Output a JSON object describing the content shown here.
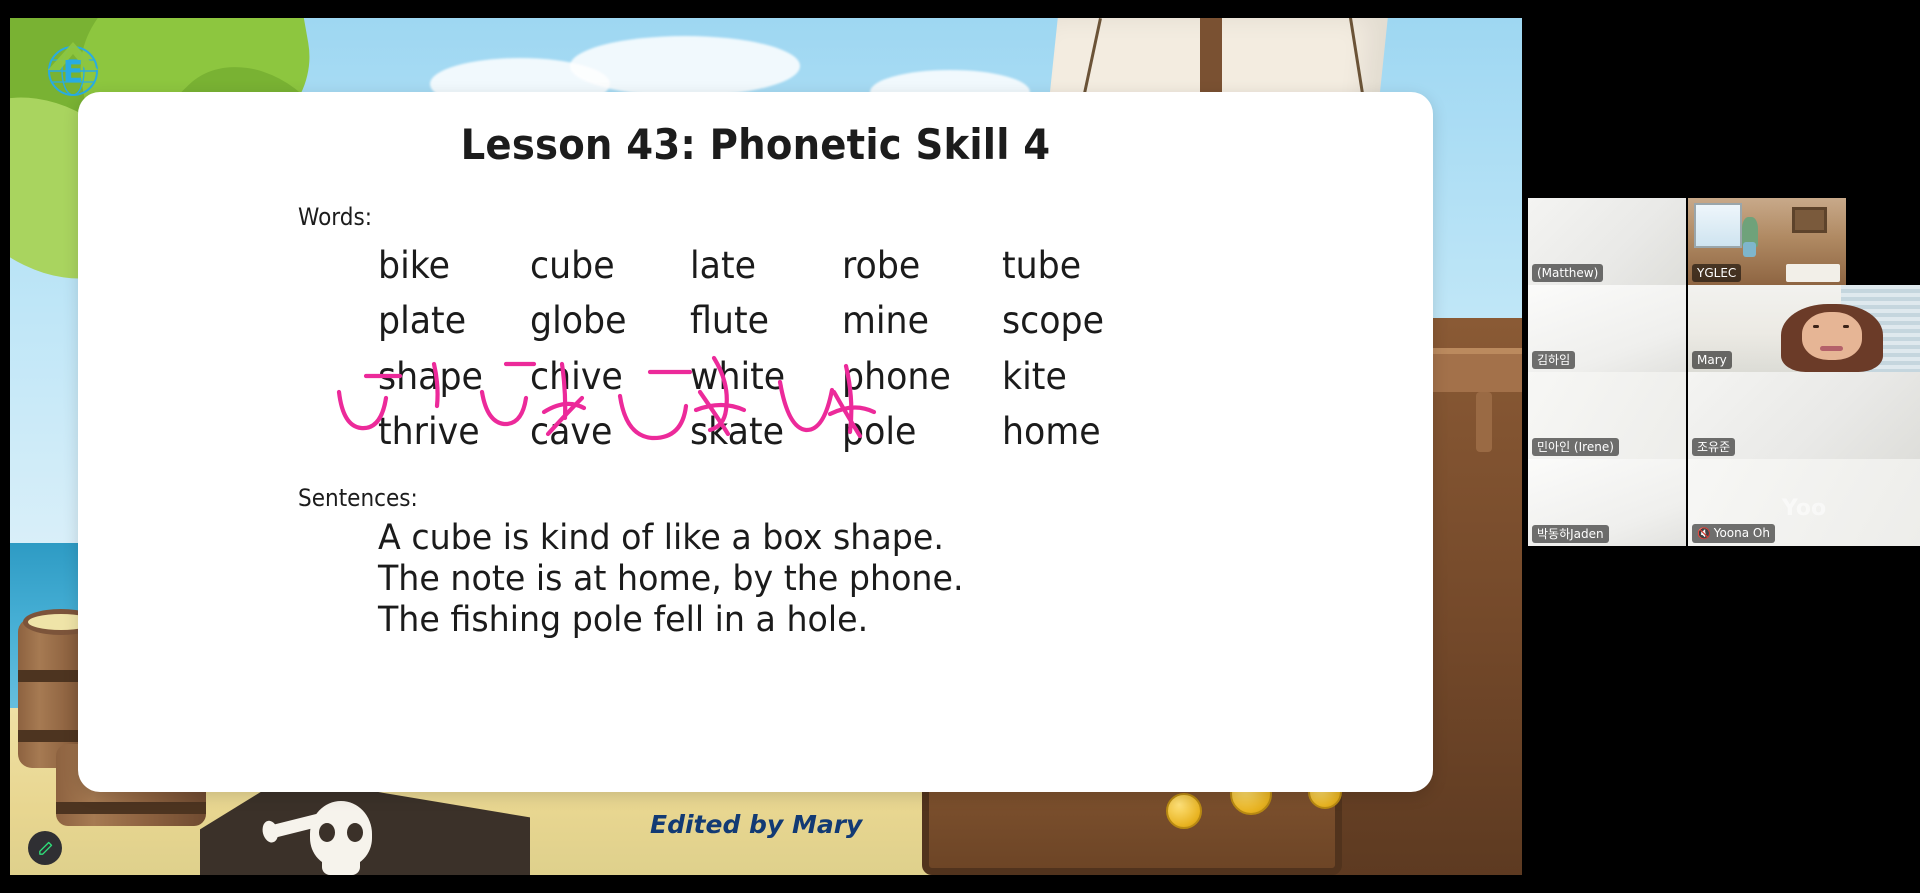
{
  "meeting": {
    "logo_icon": "globe-e-logo",
    "annotate_icon": "pencil-annotate-icon"
  },
  "slide": {
    "title": "Lesson 43: Phonetic Skill 4",
    "words_label": "Words:",
    "sentences_label": "Sentences:",
    "word_rows": [
      [
        "bike",
        "cube",
        "late",
        "robe",
        "tube"
      ],
      [
        "plate",
        "globe",
        "flute",
        "mine",
        "scope"
      ],
      [
        "shape",
        "chive",
        "white",
        "phone",
        "kite"
      ],
      [
        "thrive",
        "cave",
        "skate",
        "pole",
        "home"
      ]
    ],
    "sentences": [
      "A cube is kind of like a box shape.",
      "The note is at home, by the phone.",
      "The fishing pole fell in a hole."
    ],
    "credit": "Edited by Mary",
    "credit_color": "#123a74",
    "annotation_color": "#ec2a9a",
    "annotated_words": [
      "shape",
      "chive",
      "white",
      "phone"
    ]
  },
  "gallery": {
    "active_speaker": "Mary",
    "participants": [
      {
        "name": "(Matthew)",
        "feed": "blank-a",
        "muted": false,
        "active": false
      },
      {
        "name": "YGLEC",
        "feed": "room",
        "muted": false,
        "active": false
      },
      {
        "name": "김하임",
        "feed": "blank-b",
        "muted": false,
        "active": false
      },
      {
        "name": "Mary",
        "feed": "person",
        "muted": false,
        "active": true
      },
      {
        "name": "민아인 (Irene)",
        "feed": "blank-c",
        "muted": false,
        "active": false
      },
      {
        "name": "조유준",
        "feed": "blank-a",
        "muted": false,
        "active": false
      },
      {
        "name": "박동하Jaden",
        "feed": "blank-b",
        "muted": false,
        "active": false
      },
      {
        "name": "Yoona Oh",
        "feed": "blank-ghost",
        "muted": true,
        "active": false,
        "ghost_text": "Yoo"
      }
    ]
  }
}
